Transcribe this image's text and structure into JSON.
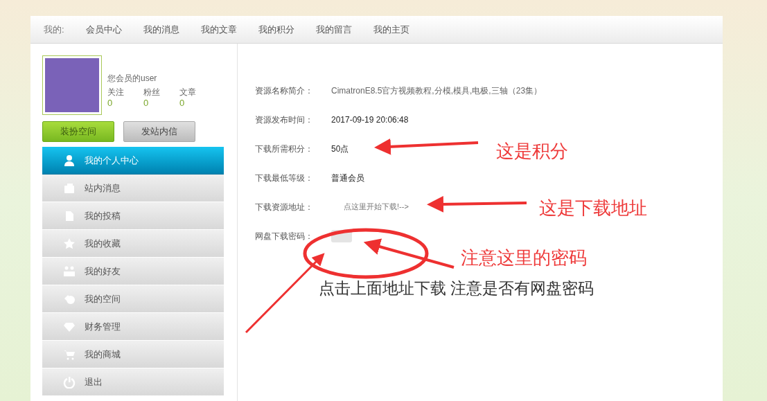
{
  "top_nav": {
    "label": "我的:",
    "links": [
      {
        "text": "会员中心"
      },
      {
        "text": "我的消息"
      },
      {
        "text": "我的文章"
      },
      {
        "text": "我的积分"
      },
      {
        "text": "我的留言"
      },
      {
        "text": "我的主页"
      }
    ]
  },
  "profile": {
    "member_text": "您会员的user",
    "stats": [
      {
        "label": "关注",
        "value": "0"
      },
      {
        "label": "粉丝",
        "value": "0"
      },
      {
        "label": "文章",
        "value": "0"
      }
    ],
    "buttons": [
      {
        "text": "装扮空间",
        "kind": "primary"
      },
      {
        "text": "发站内信",
        "kind": "secondary"
      }
    ]
  },
  "sidebar": {
    "items": [
      {
        "text": "我的个人中心",
        "selected": true
      },
      {
        "text": "站内消息",
        "selected": false
      },
      {
        "text": "我的投稿",
        "selected": false
      },
      {
        "text": "我的收藏",
        "selected": false
      },
      {
        "text": "我的好友",
        "selected": false
      },
      {
        "text": "我的空间",
        "selected": false
      },
      {
        "text": "财务管理",
        "selected": false
      },
      {
        "text": "我的商城",
        "selected": false
      },
      {
        "text": "退出",
        "selected": false
      }
    ]
  },
  "details": [
    {
      "label": "资源名称简介：",
      "value": "CimatronE8.5官方视频教程,分模,模具,电极,三轴（23集）",
      "kind": "muted"
    },
    {
      "label": "资源发布时间：",
      "value": "2017-09-19 20:06:48",
      "kind": "plain"
    },
    {
      "label": "下载所需积分：",
      "value": "50点",
      "kind": "plain"
    },
    {
      "label": "下载最低等级：",
      "value": "普通会员",
      "kind": "plain"
    },
    {
      "label": "下载资源地址：",
      "value": "点这里开始下载!-->",
      "kind": "link"
    },
    {
      "label": "网盘下载密码：",
      "kind": "hidden"
    }
  ],
  "annotations": [
    {
      "text": "这是积分",
      "kind": "red"
    },
    {
      "text": "这是下载地址",
      "kind": "red"
    },
    {
      "text": "注意这里的密码",
      "kind": "red"
    },
    {
      "text": "点击上面地址下载 注意是否有网盘密码",
      "kind": "note"
    }
  ]
}
